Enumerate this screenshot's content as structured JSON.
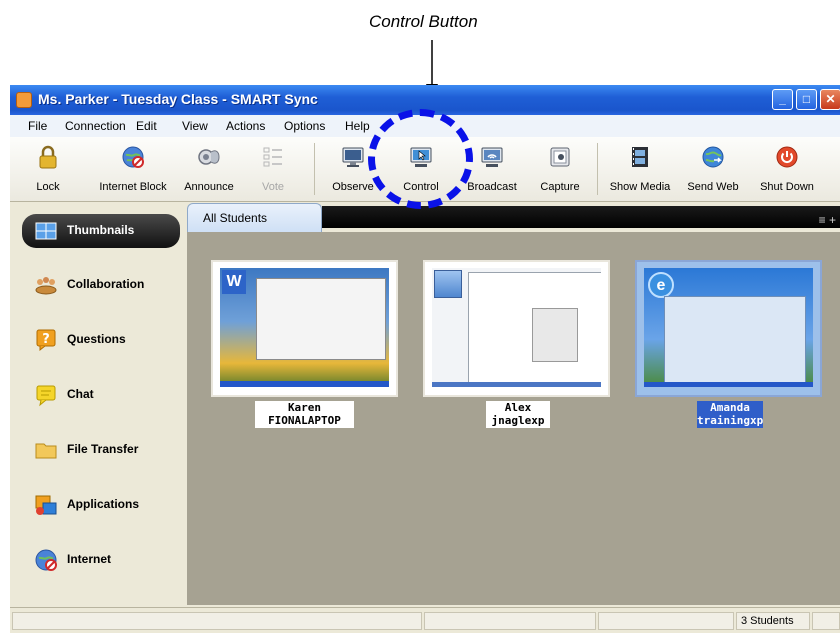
{
  "annotation": {
    "caption": "Control Button",
    "ring_color": "#0a12e8"
  },
  "window": {
    "title": "Ms.  Parker - Tuesday Class - SMART Sync",
    "controls": [
      "minimize",
      "maximize",
      "close"
    ]
  },
  "menu": [
    "File",
    "Connection",
    "Edit",
    "View",
    "Actions",
    "Options",
    "Help"
  ],
  "toolbar": [
    {
      "label": "Lock",
      "icon": "lock-icon",
      "enabled": true
    },
    {
      "label": "Internet Block",
      "icon": "internet-block-icon",
      "enabled": true
    },
    {
      "label": "Announce",
      "icon": "announce-icon",
      "enabled": true
    },
    {
      "label": "Vote",
      "icon": "vote-icon",
      "enabled": false
    },
    {
      "label": "Observe",
      "icon": "observe-icon",
      "enabled": true
    },
    {
      "label": "Control",
      "icon": "control-icon",
      "enabled": true
    },
    {
      "label": "Broadcast",
      "icon": "broadcast-icon",
      "enabled": true
    },
    {
      "label": "Capture",
      "icon": "capture-icon",
      "enabled": true
    },
    {
      "label": "Show Media",
      "icon": "show-media-icon",
      "enabled": true
    },
    {
      "label": "Send Web",
      "icon": "send-web-icon",
      "enabled": true
    },
    {
      "label": "Shut Down",
      "icon": "shut-down-icon",
      "enabled": true
    }
  ],
  "sidebar": [
    {
      "label": "Thumbnails",
      "icon": "thumbnails-icon",
      "active": true
    },
    {
      "label": "Collaboration",
      "icon": "collaboration-icon",
      "active": false
    },
    {
      "label": "Questions",
      "icon": "questions-icon",
      "active": false
    },
    {
      "label": "Chat",
      "icon": "chat-icon",
      "active": false
    },
    {
      "label": "File Transfer",
      "icon": "folder-icon",
      "active": false
    },
    {
      "label": "Applications",
      "icon": "applications-icon",
      "active": false
    },
    {
      "label": "Internet",
      "icon": "internet-icon",
      "active": false
    }
  ],
  "tabs": [
    {
      "label": "All Students",
      "active": true
    }
  ],
  "students": [
    {
      "name": "Karen",
      "computer": "FIONALAPTOP",
      "selected": false
    },
    {
      "name": "Alex",
      "computer": "jnaglexp",
      "selected": false
    },
    {
      "name": "Amanda",
      "computer": "trainingxp",
      "selected": true
    }
  ],
  "status": {
    "count": "3 Students"
  },
  "colors": {
    "titlebar": "#1f5fd6",
    "content_bg": "#A6A292",
    "selection": "#2f5ec9"
  }
}
